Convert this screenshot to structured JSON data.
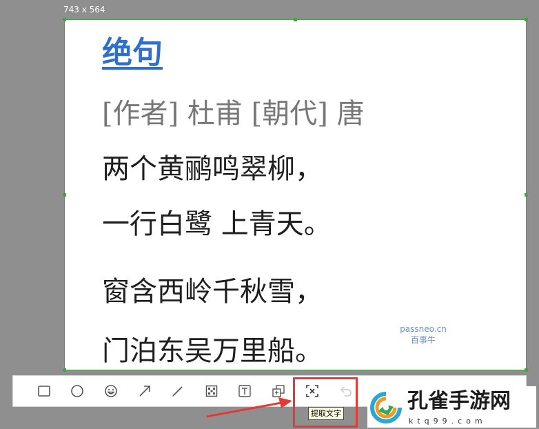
{
  "selection": {
    "size_label": "743 x 564"
  },
  "document": {
    "title": "绝句",
    "meta": "[作者] 杜甫 [朝代] 唐",
    "lines": [
      "两个黄鹂鸣翠柳，",
      "一行白鹭 上青天。",
      "窗含西岭千秋雪，",
      "门泊东吴万里船。"
    ]
  },
  "watermark": {
    "line1": "passneo.cn",
    "line2": "百事牛"
  },
  "toolbar": {
    "tools": [
      "rectangle-icon",
      "ellipse-icon",
      "emoji-icon",
      "arrow-icon",
      "pen-icon",
      "mosaic-icon",
      "text-icon",
      "pin-icon",
      "extract-text-icon",
      "undo-icon"
    ],
    "tooltip": "提取文字"
  },
  "brand": {
    "name": "孔雀手游网",
    "domain": "ktq99.com"
  },
  "colors": {
    "selection_border": "#4aa046",
    "title_link": "#2e6fcb",
    "highlight": "#e53935",
    "watermark": "#6b8fc9"
  }
}
